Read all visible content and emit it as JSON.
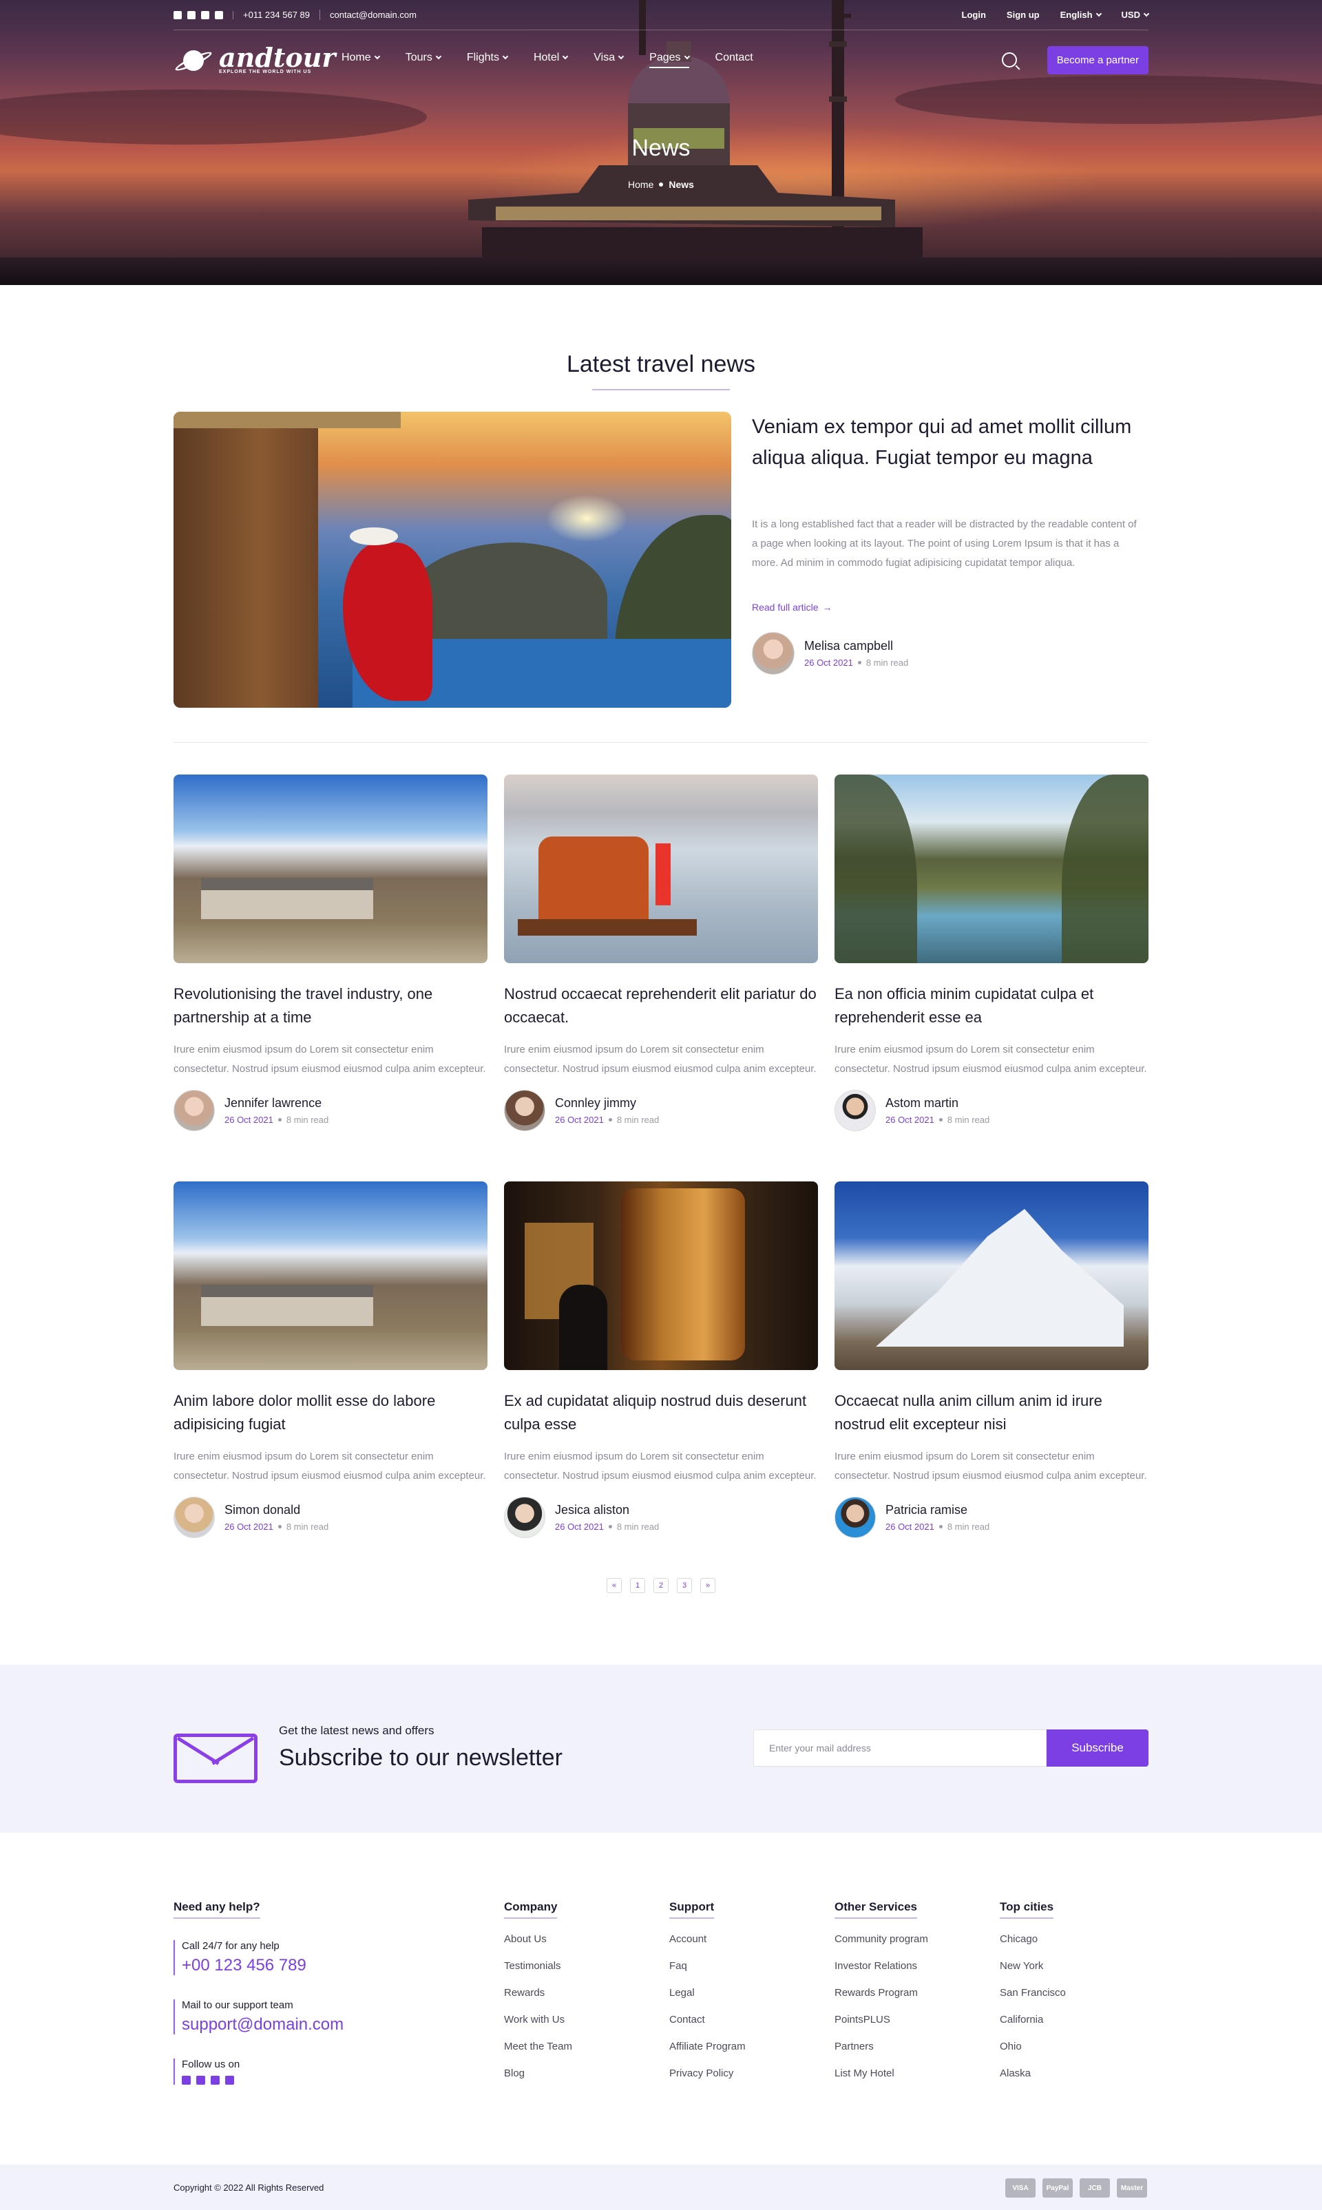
{
  "topbar": {
    "phone": "+011 234 567 89",
    "email": "contact@domain.com",
    "login": "Login",
    "signup": "Sign up",
    "language": "English",
    "currency": "USD"
  },
  "brand": {
    "name": "andtour",
    "tagline": "EXPLORE THE WORLD WITH US"
  },
  "nav": {
    "items": [
      "Home",
      "Tours",
      "Flights",
      "Hotel",
      "Visa",
      "Pages",
      "Contact"
    ],
    "partner_button": "Become a partner"
  },
  "hero": {
    "title": "News",
    "breadcrumb_home": "Home",
    "breadcrumb_current": "News"
  },
  "section_title": "Latest travel news",
  "featured": {
    "title": "Veniam ex tempor qui ad amet mollit cillum aliqua aliqua. Fugiat tempor eu magna",
    "description": "It is a long established fact that a reader will be distracted by the readable content of a page when looking at its layout. The point of using Lorem Ipsum is that it has a more. Ad minim in commodo fugiat adipisicing cupidatat tempor aliqua.",
    "link": "Read full article",
    "author": "Melisa campbell",
    "date": "26 Oct 2021",
    "read": "8 min read"
  },
  "articles": [
    {
      "title": "Revolutionising the travel industry, one partnership at a time",
      "desc": "Irure enim eiusmod ipsum do Lorem sit consectetur enim consectetur. Nostrud ipsum eiusmod eiusmod culpa anim excepteur.",
      "author": "Jennifer lawrence",
      "date": "26 Oct 2021",
      "read": "8 min read"
    },
    {
      "title": "Nostrud occaecat reprehenderit elit pariatur do occaecat.",
      "desc": "Irure enim eiusmod ipsum do Lorem sit consectetur enim consectetur. Nostrud ipsum eiusmod eiusmod culpa anim excepteur.",
      "author": "Connley jimmy",
      "date": "26 Oct 2021",
      "read": "8 min read"
    },
    {
      "title": "Ea non officia minim cupidatat culpa et reprehenderit esse ea",
      "desc": "Irure enim eiusmod ipsum do Lorem sit consectetur enim consectetur. Nostrud ipsum eiusmod eiusmod culpa anim excepteur.",
      "author": "Astom martin",
      "date": "26 Oct 2021",
      "read": "8 min read"
    },
    {
      "title": "Anim labore dolor mollit esse do labore adipisicing fugiat",
      "desc": "Irure enim eiusmod ipsum do Lorem sit consectetur enim consectetur. Nostrud ipsum eiusmod eiusmod culpa anim excepteur.",
      "author": "Simon donald",
      "date": "26 Oct 2021",
      "read": "8 min read"
    },
    {
      "title": "Ex ad cupidatat aliquip nostrud duis deserunt culpa esse",
      "desc": "Irure enim eiusmod ipsum do Lorem sit consectetur enim consectetur. Nostrud ipsum eiusmod eiusmod culpa anim excepteur.",
      "author": "Jesica aliston",
      "date": "26 Oct 2021",
      "read": "8 min read"
    },
    {
      "title": "Occaecat nulla anim cillum anim id irure nostrud elit excepteur nisi",
      "desc": "Irure enim eiusmod ipsum do Lorem sit consectetur enim consectetur. Nostrud ipsum eiusmod eiusmod culpa anim excepteur.",
      "author": "Patricia ramise",
      "date": "26 Oct 2021",
      "read": "8 min read"
    }
  ],
  "pagination": {
    "prev": "«",
    "pages": [
      "1",
      "2",
      "3"
    ],
    "next": "»"
  },
  "newsletter": {
    "kicker": "Get the latest news and offers",
    "title": "Subscribe to our newsletter",
    "placeholder": "Enter your mail address",
    "button": "Subscribe"
  },
  "footer": {
    "help": {
      "heading": "Need any help?",
      "call_label": "Call 24/7 for any help",
      "phone": "+00 123 456 789",
      "mail_label": "Mail to our support team",
      "email": "support@domain.com",
      "follow_label": "Follow us on"
    },
    "columns": [
      {
        "heading": "Company",
        "links": [
          "About Us",
          "Testimonials",
          "Rewards",
          "Work with Us",
          "Meet the Team",
          "Blog"
        ]
      },
      {
        "heading": "Support",
        "links": [
          "Account",
          "Faq",
          "Legal",
          "Contact",
          "Affiliate Program",
          "Privacy Policy"
        ]
      },
      {
        "heading": "Other Services",
        "links": [
          "Community program",
          "Investor Relations",
          "Rewards Program",
          "PointsPLUS",
          "Partners",
          "List My Hotel"
        ]
      },
      {
        "heading": "Top cities",
        "links": [
          "Chicago",
          "New York",
          "San Francisco",
          "California",
          "Ohio",
          "Alaska"
        ]
      }
    ],
    "copyright": "Copyright © 2022 All Rights Reserved",
    "payments": [
      "VISA",
      "PayPal",
      "JCB",
      "Master"
    ]
  },
  "colors": {
    "accent": "#7b3fe4",
    "newsletter_bg": "#f1f2fa",
    "text": "#1c1c30",
    "muted": "#8a8a98"
  }
}
